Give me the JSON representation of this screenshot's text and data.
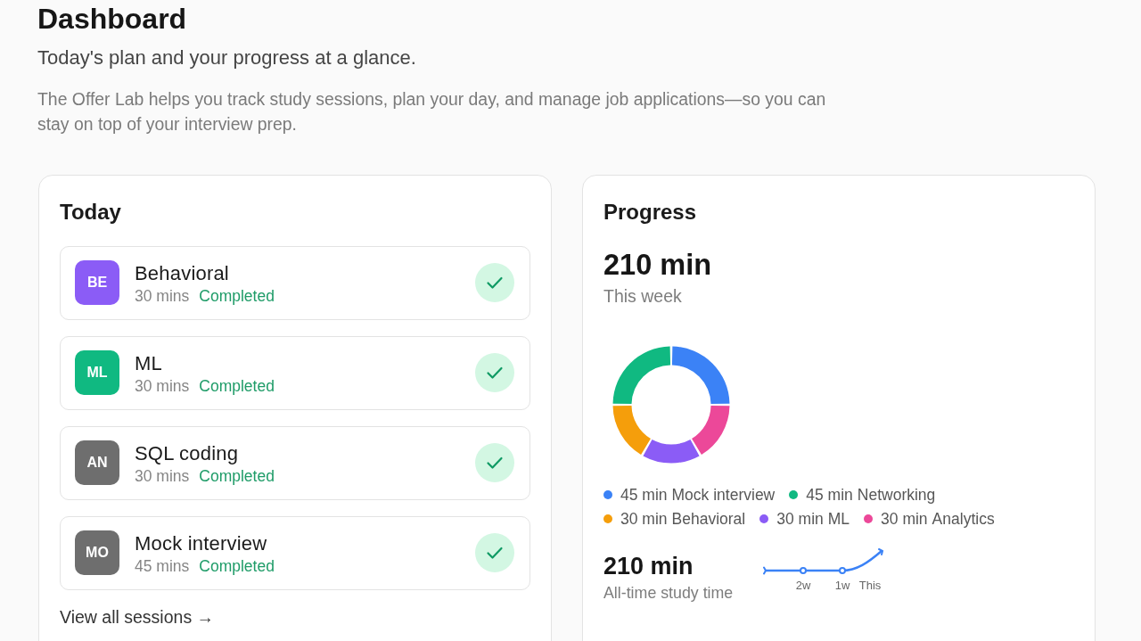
{
  "page": {
    "title": "Dashboard",
    "subtitle": "Today's plan and your progress at a glance.",
    "description": "The Offer Lab helps you track study sessions, plan your day, and manage job applications—so you can stay on top of your interview prep."
  },
  "today": {
    "title": "Today",
    "sessions": [
      {
        "initials": "BE",
        "color": "#8b5cf6",
        "name": "Behavioral",
        "duration": "30 mins",
        "status": "Completed",
        "completed": true
      },
      {
        "initials": "ML",
        "color": "#10b981",
        "name": "ML",
        "duration": "30 mins",
        "status": "Completed",
        "completed": true
      },
      {
        "initials": "AN",
        "color": "#6e6e6e",
        "name": "SQL coding",
        "duration": "30 mins",
        "status": "Completed",
        "completed": true
      },
      {
        "initials": "MO",
        "color": "#6e6e6e",
        "name": "Mock interview",
        "duration": "45 mins",
        "status": "Completed",
        "completed": true
      }
    ],
    "link": "View all sessions →"
  },
  "progress": {
    "title": "Progress",
    "week_total": "210 min",
    "week_label": "This week",
    "chart_data": {
      "type": "donut",
      "categories": [
        "Mock interview",
        "Networking",
        "Behavioral",
        "ML",
        "Analytics"
      ],
      "values": [
        25,
        25,
        16.67,
        16.67,
        16.66
      ],
      "colors": [
        "#3b82f6",
        "#10b981",
        "#f59e0b",
        "#8b5cf6",
        "#ec4899"
      ]
    },
    "legend": [
      {
        "amount": "45 min"
      },
      {
        "amount": "45 min"
      },
      {
        "amount": "30 min"
      },
      {
        "amount": "30 min"
      },
      {
        "amount": "30 min"
      }
    ],
    "all_time_total": "210 min",
    "all_time_label": "All-time study time",
    "trend_labels": [
      "2w",
      "1w",
      "This"
    ]
  }
}
